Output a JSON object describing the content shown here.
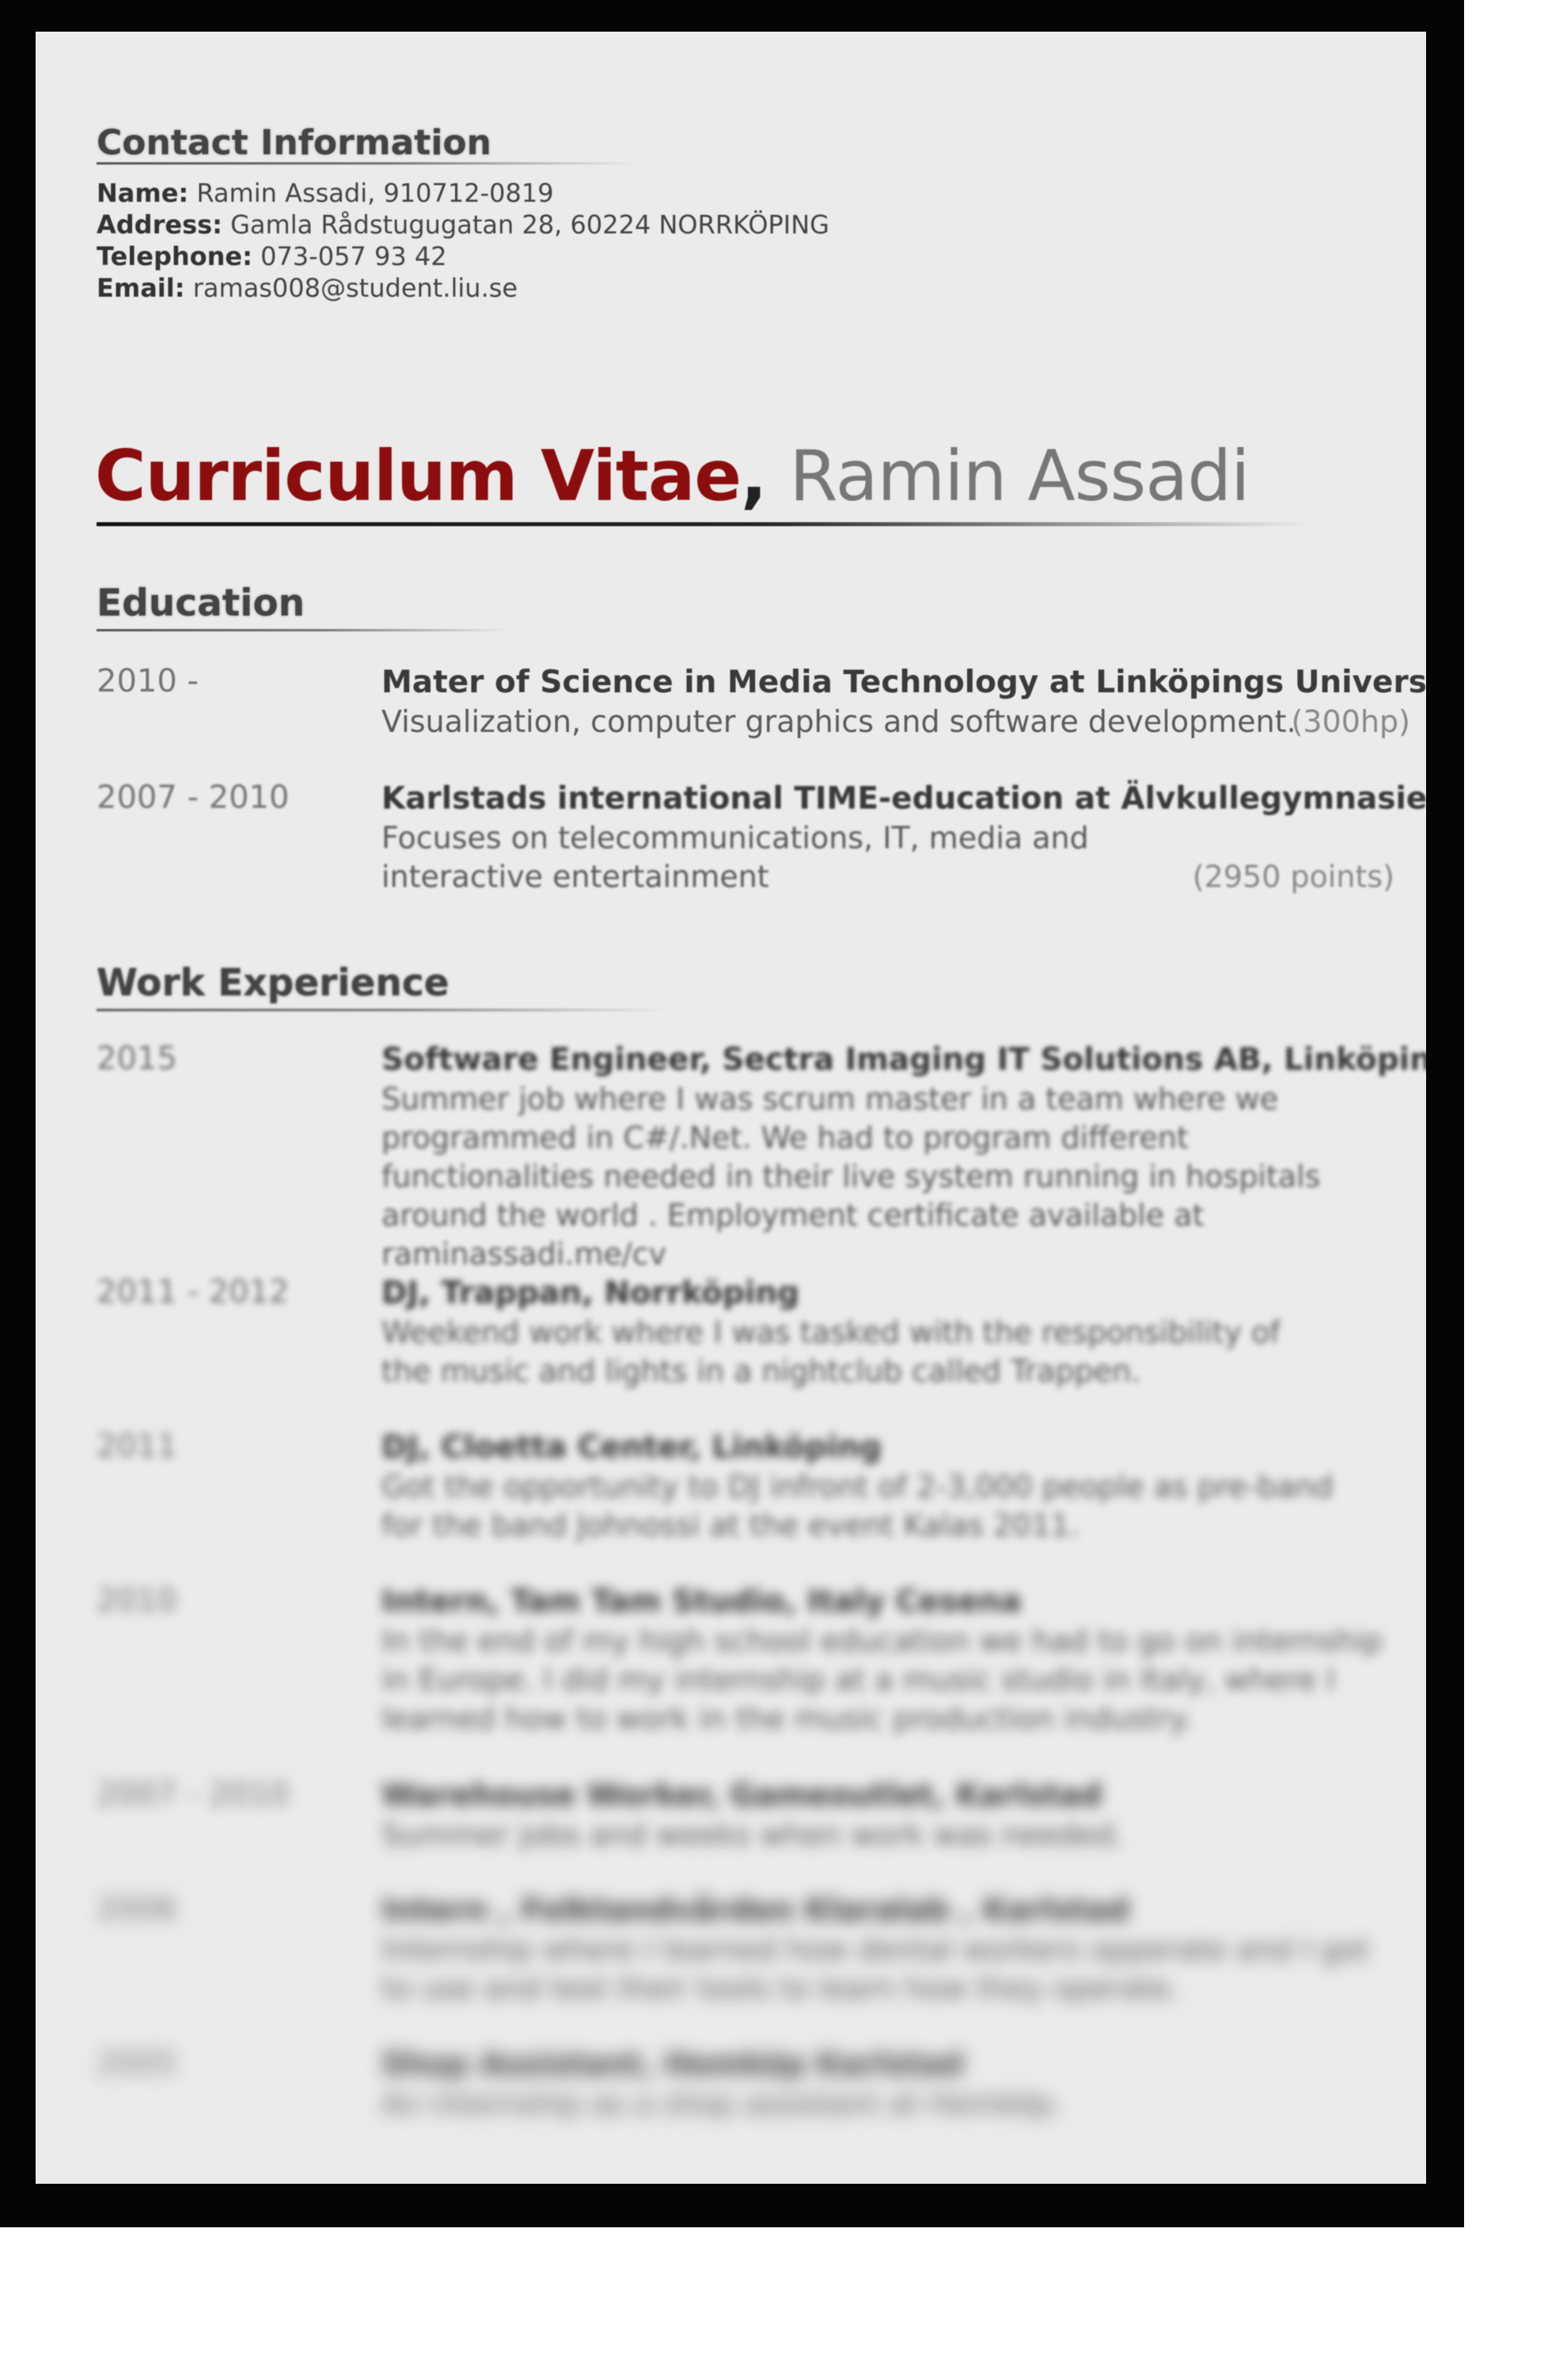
{
  "contact": {
    "heading": "Contact Information",
    "lines": [
      {
        "label": "Name:",
        "value": "Ramin Assadi, 910712-0819"
      },
      {
        "label": "Address:",
        "value": "Gamla Rådstugugatan 28, 60224 NORRKÖPING"
      },
      {
        "label": "Telephone:",
        "value": "073-057 93 42"
      },
      {
        "label": "Email:",
        "value": "ramas008@student.liu.se"
      }
    ]
  },
  "title": {
    "main": "Curriculum Vitae",
    "separator": ",",
    "name": "Ramin Assadi"
  },
  "education": {
    "heading": "Education",
    "entries": [
      {
        "date": "2010 -",
        "title": "Mater of Science in Media Technology at Linköpings Universitet",
        "desc": "Visualization, computer graphics and software development.",
        "points": "(300hp)"
      },
      {
        "date": "2007 - 2010",
        "title": "Karlstads international TIME-education at Älvkullegymnasiet",
        "desc": "Focuses on telecommunications, IT, media and interactive entertainment",
        "points": "(2950 points)"
      }
    ]
  },
  "work": {
    "heading": "Work Experience",
    "entries": [
      {
        "date": "2015",
        "title": "Software Engineer, Sectra Imaging IT Solutions AB, Linköping",
        "desc": "Summer job where I was scrum master in a team where we programmed in C#/.Net. We had to program different functionalities needed in their live system running in hospitals around the world . Employment certificate available at raminassadi.me/cv"
      },
      {
        "date": "2011 - 2012",
        "title": "DJ, Trappan, Norrköping",
        "desc": "Weekend work where I was tasked with the responsibility of the music and lights in a nightclub called Trappen."
      },
      {
        "date": "2011",
        "title": "DJ, Cloetta Center, Linköping",
        "desc": "Got the opportunity to DJ infront of 2-3,000 people as pre-band for the band Johnossi at the event Kalas 2011."
      },
      {
        "date": "2010",
        "title": "Intern, Tam Tam Studio, Italy Cesena",
        "desc": "In the end of my high school education we had to go on internship in Europe. I did my internship at a music studio in Italy, where I learned how to work in the music production industry."
      },
      {
        "date": "2007 - 2010",
        "title": "Warehouse Worker, Gameoutlet, Karlstad",
        "desc": "Summer jobs and weeks when work was needed."
      },
      {
        "date": "2006",
        "title": "Intern , Folktandvården Klaralab , Karlstad",
        "desc": "Internship where I learned how dental workers opperate and I got to use and test their tools to learn how they operate."
      },
      {
        "date": "2005",
        "title": "Shop Assistant, Hemköp Karlstad",
        "desc": "An internship as a shop assistant at Hemköp."
      }
    ]
  }
}
